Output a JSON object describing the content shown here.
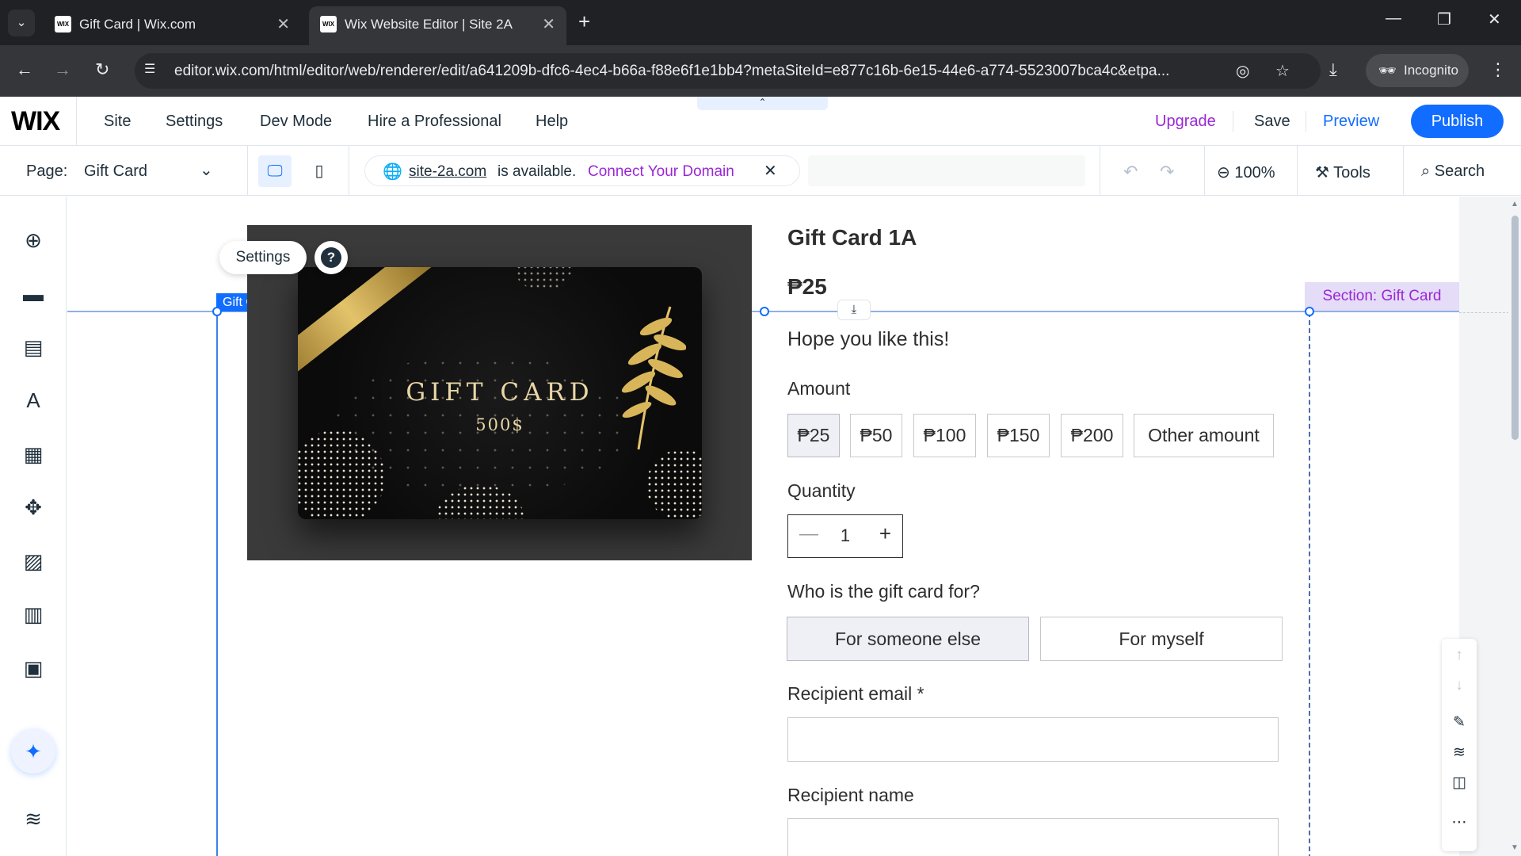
{
  "browser": {
    "tabs": [
      {
        "title": "Gift Card | Wix.com",
        "favicon": "WIX"
      },
      {
        "title": "Wix Website Editor | Site 2A",
        "favicon": "WIX"
      }
    ],
    "url": "editor.wix.com/html/editor/web/renderer/edit/a641209b-dfc6-4ec4-b66a-f88e6f1e1bb4?metaSiteId=e877c16b-6e15-44e6-a774-5523007bca4c&etpa...",
    "incognito_label": "Incognito"
  },
  "wix": {
    "logo": "WIX",
    "menu": [
      "Site",
      "Settings",
      "Dev Mode",
      "Hire a Professional",
      "Help"
    ],
    "upgrade": "Upgrade",
    "save": "Save",
    "preview": "Preview",
    "publish": "Publish",
    "page_label": "Page:",
    "page_name": "Gift Card",
    "domain": {
      "name": "site-2a.com",
      "available_text": "is available.",
      "connect": "Connect Your Domain"
    },
    "zoom": "100%",
    "tools": "Tools",
    "search": "Search"
  },
  "canvas": {
    "settings_label": "Settings",
    "help_symbol": "?",
    "element_tag": "Gift Card",
    "section_label": "Section: Gift Card",
    "card_image": {
      "line1": "GIFT CARD",
      "line2": "500$"
    }
  },
  "product": {
    "title": "Gift Card 1A",
    "price": "₱25",
    "description": "Hope you like this!",
    "amount_label": "Amount",
    "amounts": [
      "₱25",
      "₱50",
      "₱100",
      "₱150",
      "₱200",
      "Other amount"
    ],
    "selected_amount": "₱25",
    "quantity_label": "Quantity",
    "quantity": "1",
    "who_label": "Who is the gift card for?",
    "who_options": [
      "For someone else",
      "For myself"
    ],
    "recipient_email_label": "Recipient email *",
    "recipient_name_label": "Recipient name"
  },
  "colors": {
    "wix_blue": "#116dff",
    "upgrade_purple": "#9a27d5"
  }
}
